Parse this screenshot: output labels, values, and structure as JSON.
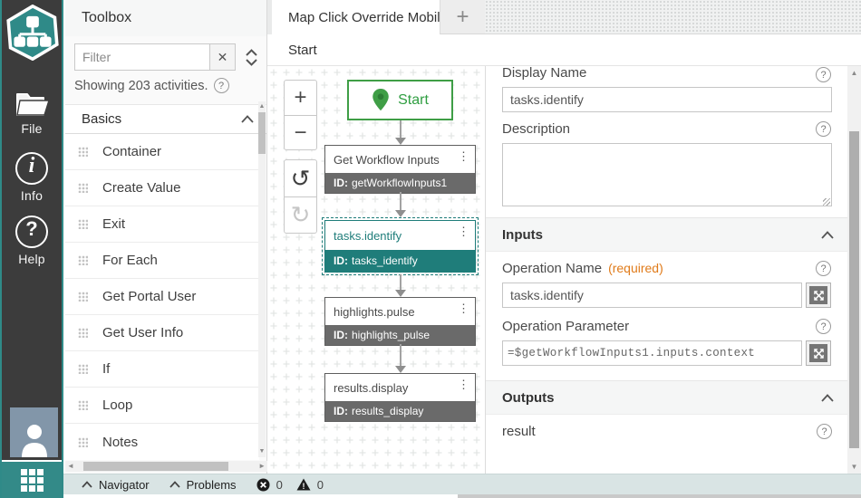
{
  "colors": {
    "teal": "#1f7d7a",
    "teal_logo": "#2f8a88",
    "green": "#3f9e46",
    "rail_bg": "#3c3c3c",
    "node_idbar_gray": "#6a6a6a",
    "statusbar_bg": "#d9e4e4",
    "required_orange": "#e07b1a"
  },
  "icons": {
    "close": "✕",
    "clear": "✕",
    "add": "+",
    "kebab": "⋮",
    "undo": "↺",
    "redo": "↻",
    "zoom_in": "+",
    "zoom_out": "−",
    "help": "?",
    "up_arrow": "▲",
    "down_arrow": "▼",
    "left_arrow": "◄",
    "right_arrow": "►"
  },
  "rail": {
    "items": [
      {
        "label": "File"
      },
      {
        "label": "Info"
      },
      {
        "label": "Help"
      }
    ]
  },
  "toolbox": {
    "title": "Toolbox",
    "filter_placeholder": "Filter",
    "showing_text": "Showing 203 activities.",
    "section_label": "Basics",
    "items": [
      {
        "label": "Container"
      },
      {
        "label": "Create Value"
      },
      {
        "label": "Exit"
      },
      {
        "label": "For Each"
      },
      {
        "label": "Get Portal User"
      },
      {
        "label": "Get User Info"
      },
      {
        "label": "If"
      },
      {
        "label": "Loop"
      },
      {
        "label": "Notes"
      }
    ]
  },
  "tabs": {
    "active_label": "Map Click Override Mobile"
  },
  "breadcrumb": {
    "label": "Start"
  },
  "canvas": {
    "start": {
      "label": "Start"
    },
    "nodes": [
      {
        "title": "Get Workflow Inputs",
        "id_prefix": "ID:",
        "id": "getWorkflowInputs1"
      },
      {
        "title": "tasks.identify",
        "id_prefix": "ID:",
        "id": "tasks_identify"
      },
      {
        "title": "highlights.pulse",
        "id_prefix": "ID:",
        "id": "highlights_pulse"
      },
      {
        "title": "results.display",
        "id_prefix": "ID:",
        "id": "results_display"
      }
    ]
  },
  "properties": {
    "display_name": {
      "label": "Display Name",
      "value": "tasks.identify"
    },
    "description": {
      "label": "Description",
      "value": ""
    },
    "inputs_section": {
      "label": "Inputs"
    },
    "operation_name": {
      "label": "Operation Name",
      "required_note": "(required)",
      "value": "tasks.identify"
    },
    "operation_parameter": {
      "label": "Operation Parameter",
      "value": "=$getWorkflowInputs1.inputs.context"
    },
    "outputs_section": {
      "label": "Outputs"
    },
    "outputs": [
      {
        "label": "result"
      }
    ]
  },
  "statusbar": {
    "navigator_label": "Navigator",
    "problems_label": "Problems",
    "error_count": "0",
    "warning_count": "0"
  }
}
